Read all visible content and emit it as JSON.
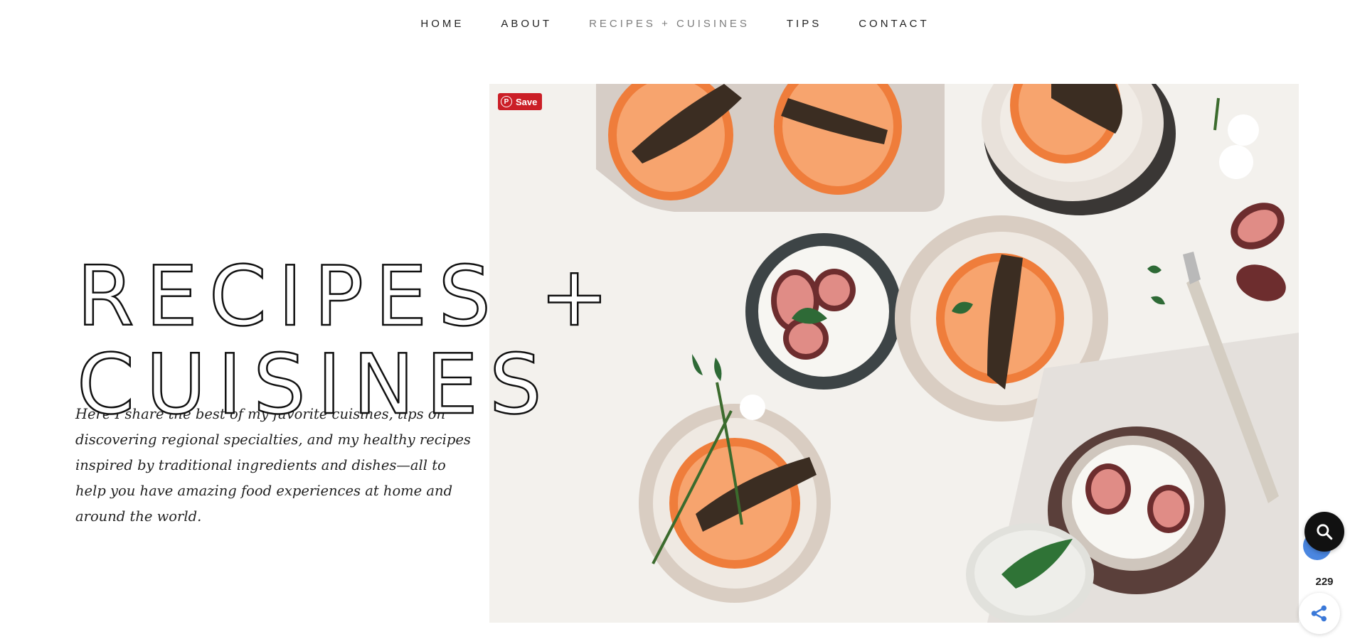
{
  "nav": {
    "items": [
      {
        "label": "HOME",
        "active": false
      },
      {
        "label": "ABOUT",
        "active": false
      },
      {
        "label": "RECIPES + CUISINES",
        "active": true
      },
      {
        "label": "TIPS",
        "active": false
      },
      {
        "label": "CONTACT",
        "active": false
      }
    ]
  },
  "hero": {
    "title_line1": "RECIPES +",
    "title_line2": "CUISINES",
    "intro": "Here I share the best of my favorite cuisines, tips on discovering regional specialties, and my healthy recipes inspired by traditional ingredients and dishes—all to help you have amazing food experiences at home and around the world."
  },
  "pinterest": {
    "save_label": "Save",
    "icon": "pinterest-icon",
    "color": "#cb1f27"
  },
  "floating": {
    "search_icon": "search-icon",
    "share_count": "229",
    "share_icon": "share-icon",
    "accent": "#4a86e0"
  }
}
